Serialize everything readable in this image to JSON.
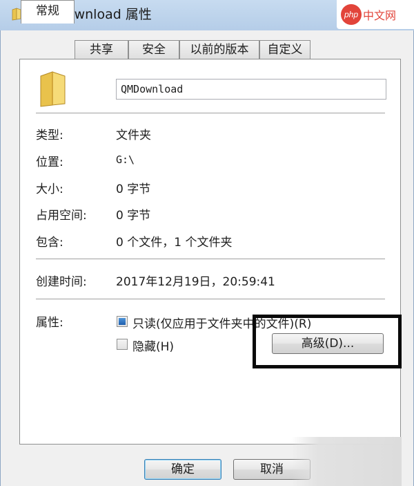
{
  "window": {
    "title": "QMDownload 属性",
    "watermark_logo": "php",
    "watermark_text": "中文网"
  },
  "tabs": [
    {
      "label": "常规",
      "active": true
    },
    {
      "label": "共享",
      "active": false
    },
    {
      "label": "安全",
      "active": false
    },
    {
      "label": "以前的版本",
      "active": false
    },
    {
      "label": "自定义",
      "active": false
    }
  ],
  "general": {
    "folder_name": "QMDownload",
    "rows": [
      {
        "label": "类型:",
        "value": "文件夹"
      },
      {
        "label": "位置:",
        "value": "G:\\"
      },
      {
        "label": "大小:",
        "value": "0 字节"
      },
      {
        "label": "占用空间:",
        "value": "0 字节"
      },
      {
        "label": "包含:",
        "value": "0 个文件，1 个文件夹"
      },
      {
        "label": "创建时间:",
        "value": "2017年12月19日，20:59:41"
      }
    ],
    "attributes_label": "属性:",
    "readonly_label": "只读(仅应用于文件夹中的文件)(R)",
    "readonly_checked": true,
    "hidden_label": "隐藏(H)",
    "hidden_checked": false,
    "advanced_button": "高级(D)..."
  },
  "footer": {
    "ok_label": "确定",
    "cancel_label": "取消"
  },
  "colors": {
    "titlebar": "#b9d1ea",
    "highlight_border": "#0a0a0a",
    "watermark": "#e2443a"
  }
}
